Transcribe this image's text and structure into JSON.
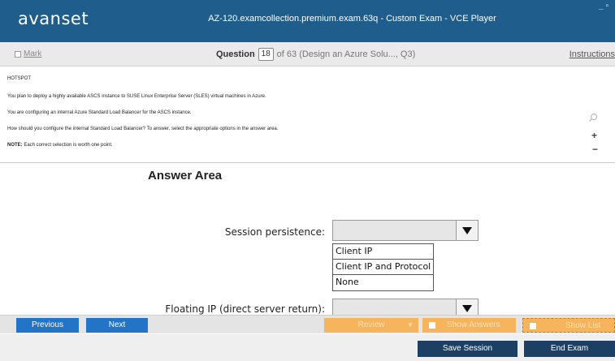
{
  "app": {
    "logo": "avanset",
    "window_title": "AZ-120.examcollection.premium.exam.63q - Custom Exam - VCE Player",
    "window_controls": "_ ▫"
  },
  "question_bar": {
    "mark_label": "Mark",
    "question_label": "Question",
    "question_number": "18",
    "of_text": "of 63 (Design an Azure Solu..., Q3)",
    "instructions_label": "Instructions"
  },
  "question_text": {
    "heading": "HOTSPOT",
    "line1": "You plan to deploy a highly available ASCS instance to SUSE Linux Enterprise Server (SLES) virtual machines in Azure.",
    "line2": "You are configuring an internal Azure Standard Load Balancer for the ASCS instance.",
    "line3": "How should you configure the internal Standard Load Balancer? To answer, select the appropriate options in the answer area.",
    "note_label": "NOTE:",
    "note_text": " Each correct selection is worth one point.",
    "zoom_in": "+",
    "zoom_out": "−"
  },
  "answer_area": {
    "title": "Answer Area",
    "session_persistence_label": "Session persistence:",
    "session_persistence_options": [
      "Client IP",
      "Client IP and Protocol",
      "None"
    ],
    "floating_ip_label": "Floating IP (direct server return):"
  },
  "nav": {
    "previous": "Previous",
    "next": "Next",
    "review": "Review",
    "show_answers": "Show Answers",
    "show_list": "Show List"
  },
  "footer": {
    "save_session": "Save Session",
    "end_exam": "End Exam"
  }
}
